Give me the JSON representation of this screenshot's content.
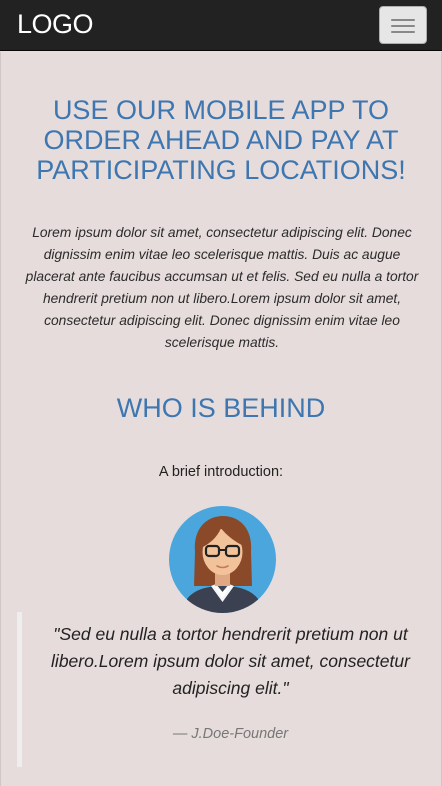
{
  "navbar": {
    "logo": "LOGO",
    "menu_icon": "hamburger-icon"
  },
  "hero": {
    "headline": "USE OUR MOBILE APP TO ORDER AHEAD AND PAY AT PARTICIPATING LOCATIONS!",
    "paragraph": "Lorem ipsum dolor sit amet, consectetur adipiscing elit. Donec dignissim enim vitae leo scelerisque mattis. Duis ac augue placerat ante faucibus accumsan ut et felis. Sed eu nulla a tortor hendrerit pretium non ut libero.Lorem ipsum dolor sit amet, consectetur adipiscing elit. Donec dignissim enim vitae leo scelerisque mattis."
  },
  "about": {
    "title": "WHO IS BEHIND",
    "subtitle": "A brief introduction:",
    "avatar_icon": "woman-avatar-icon",
    "quote": "\"Sed eu nulla a tortor hendrerit pretium non ut libero.Lorem ipsum dolor sit amet, consectetur adipiscing elit.\"",
    "author": "— J.Doe-Founder"
  },
  "colors": {
    "page_background": "#e6dcdb",
    "navbar_background": "#222222",
    "heading_blue": "#3d76b0",
    "avatar_circle": "#4aa6dc"
  }
}
